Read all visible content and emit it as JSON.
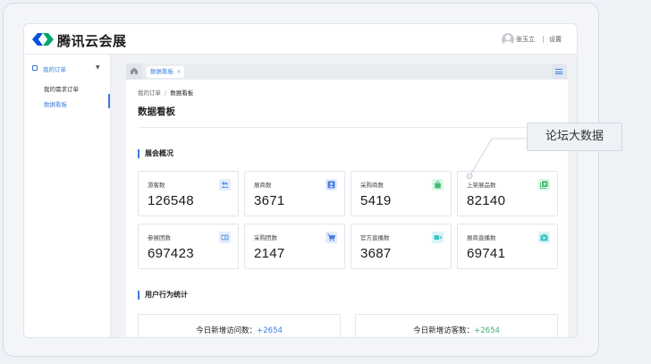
{
  "header": {
    "brand": "腾讯云会展",
    "user_name": "张玉立",
    "settings_label": "设置"
  },
  "sidebar": {
    "group_label": "我的订单",
    "items": [
      {
        "label": "我的需求订单"
      },
      {
        "label": "数据看板"
      }
    ]
  },
  "tabs": {
    "data_tab_label": "数据看板",
    "close_glyph": "×"
  },
  "breadcrumb": {
    "root": "我的订单",
    "separator": "/",
    "current": "数据看板"
  },
  "page_title": "数据看板",
  "overview": {
    "title": "展会概况",
    "cards": [
      {
        "label": "游客数",
        "value": "126548",
        "icon": "users-icon",
        "color": "#5b8ff0"
      },
      {
        "label": "展商数",
        "value": "3671",
        "icon": "contact-card-icon",
        "color": "#4a7fe0"
      },
      {
        "label": "采购商数",
        "value": "5419",
        "icon": "bag-icon",
        "color": "#3dbd74"
      },
      {
        "label": "上架展品数",
        "value": "82140",
        "icon": "add-library-icon",
        "color": "#3dbd74"
      },
      {
        "label": "参展团数",
        "value": "697423",
        "icon": "badge-icon",
        "color": "#7ea7ea"
      },
      {
        "label": "采购团数",
        "value": "2147",
        "icon": "cart-icon",
        "color": "#4a7fe0"
      },
      {
        "label": "官方直播数",
        "value": "3687",
        "icon": "video-icon",
        "color": "#3ec3c6"
      },
      {
        "label": "展商直播数",
        "value": "69741",
        "icon": "live-play-icon",
        "color": "#3ec3c6"
      }
    ]
  },
  "user_behavior": {
    "title": "用户行为统计",
    "stats": [
      {
        "label": "今日新增访问数：",
        "value": "+2654",
        "color": "#3b7ddd"
      },
      {
        "label": "今日新增访客数：",
        "value": "+2654",
        "color": "#3cb371"
      }
    ]
  },
  "callout": {
    "text": "论坛大数据"
  },
  "colors": {
    "accent": "#3b7ddd",
    "green": "#3cb371"
  }
}
